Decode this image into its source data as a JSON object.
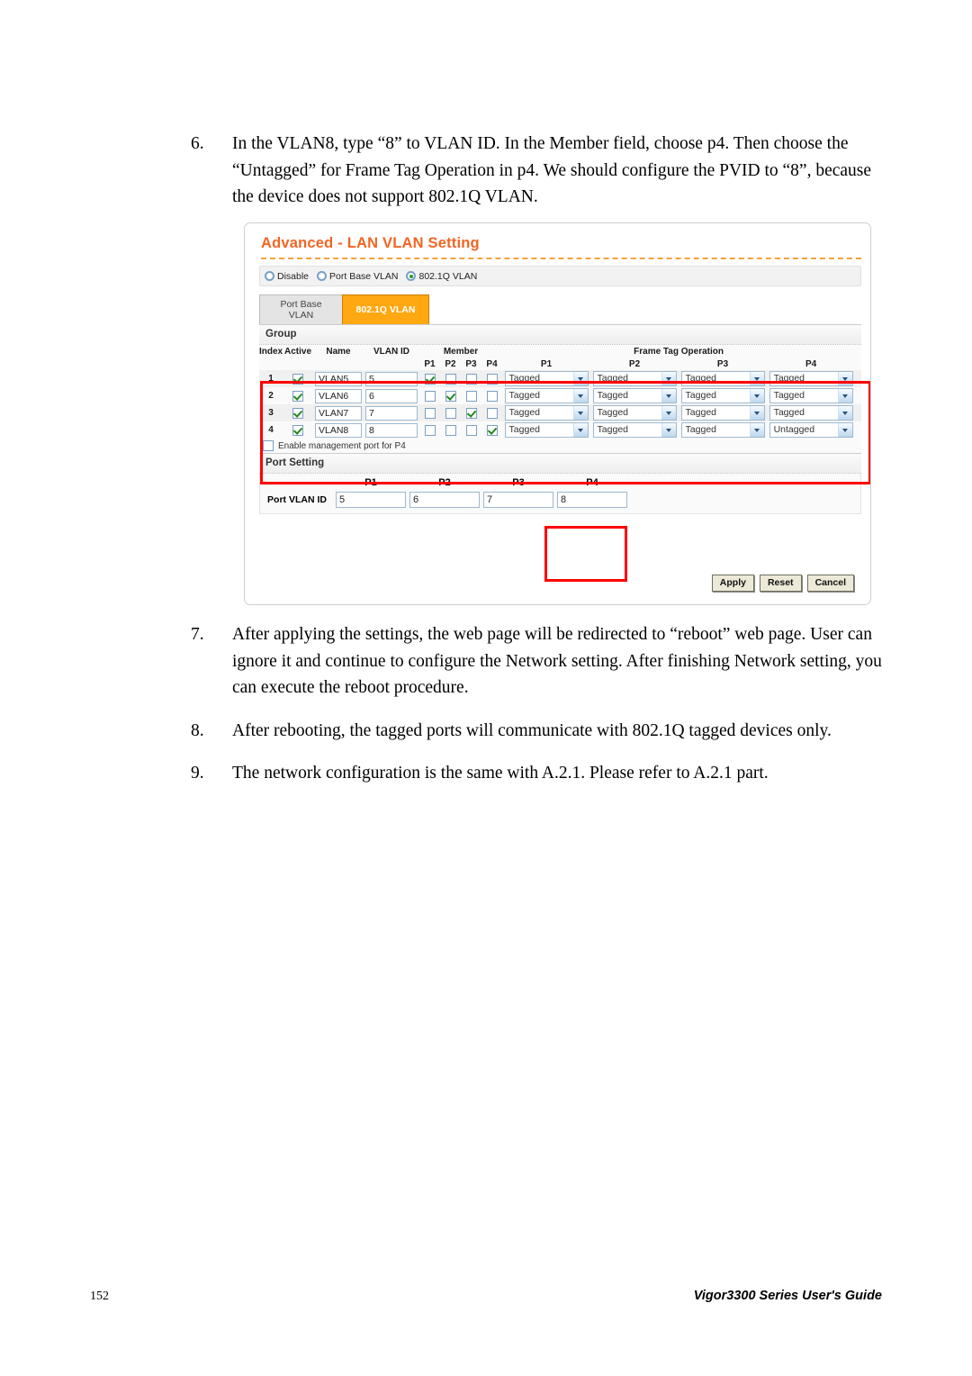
{
  "document": {
    "steps": [
      {
        "number": "6.",
        "text": "In the VLAN8, type “8” to VLAN ID. In the Member field, choose p4. Then choose the “Untagged” for Frame Tag Operation in p4. We should configure the PVID to “8”, because the device does not support 802.1Q VLAN."
      },
      {
        "number": "7.",
        "text": "After applying the settings, the web page will be redirected to “reboot” web page. User can ignore it and continue to configure the Network setting. After finishing Network setting, you can execute the reboot procedure."
      },
      {
        "number": "8.",
        "text": "After rebooting, the tagged ports will communicate with 802.1Q tagged devices only."
      },
      {
        "number": "9.",
        "text": "The network configuration is the same with A.2.1. Please refer to A.2.1 part."
      }
    ],
    "footer": {
      "page_number": "152",
      "guide_title": "Vigor3300 Series User's Guide"
    }
  },
  "screenshot": {
    "title": "Advanced - LAN VLAN Setting",
    "title_color": "#f26522",
    "mode_radios": [
      {
        "label": "Disable",
        "selected": false
      },
      {
        "label": "Port Base VLAN",
        "selected": false
      },
      {
        "label": "802.1Q VLAN",
        "selected": true
      }
    ],
    "tabs": [
      {
        "label": "Port Base VLAN",
        "active": false
      },
      {
        "label": "802.1Q VLAN",
        "active": true
      }
    ],
    "group": {
      "section_label": "Group",
      "headers": {
        "index": "Index",
        "active": "Active",
        "name": "Name",
        "vlan_id": "VLAN ID",
        "member": "Member",
        "frame_tag_operation": "Frame Tag Operation"
      },
      "port_labels": [
        "P1",
        "P2",
        "P3",
        "P4"
      ],
      "rows": [
        {
          "index": "1",
          "active": true,
          "name": "VLAN5",
          "vlan_id": "5",
          "member": [
            true,
            false,
            false,
            false
          ],
          "frame_tag": [
            "Tagged",
            "Tagged",
            "Tagged",
            "Tagged"
          ]
        },
        {
          "index": "2",
          "active": true,
          "name": "VLAN6",
          "vlan_id": "6",
          "member": [
            false,
            true,
            false,
            false
          ],
          "frame_tag": [
            "Tagged",
            "Tagged",
            "Tagged",
            "Tagged"
          ]
        },
        {
          "index": "3",
          "active": true,
          "name": "VLAN7",
          "vlan_id": "7",
          "member": [
            false,
            false,
            true,
            false
          ],
          "frame_tag": [
            "Tagged",
            "Tagged",
            "Tagged",
            "Tagged"
          ]
        },
        {
          "index": "4",
          "active": true,
          "name": "VLAN8",
          "vlan_id": "8",
          "member": [
            false,
            false,
            false,
            true
          ],
          "frame_tag": [
            "Tagged",
            "Tagged",
            "Tagged",
            "Untagged"
          ]
        }
      ],
      "management_port": {
        "label": "Enable management port for P4",
        "checked": false
      }
    },
    "port_setting": {
      "section_label": "Port Setting",
      "port_headers": [
        "P1",
        "P2",
        "P3",
        "P4"
      ],
      "row_label": "Port VLAN ID",
      "values": [
        "5",
        "6",
        "7",
        "8"
      ]
    },
    "buttons": [
      {
        "label": "Apply"
      },
      {
        "label": "Reset"
      },
      {
        "label": "Cancel"
      }
    ],
    "callout_color": "#ff0000"
  }
}
